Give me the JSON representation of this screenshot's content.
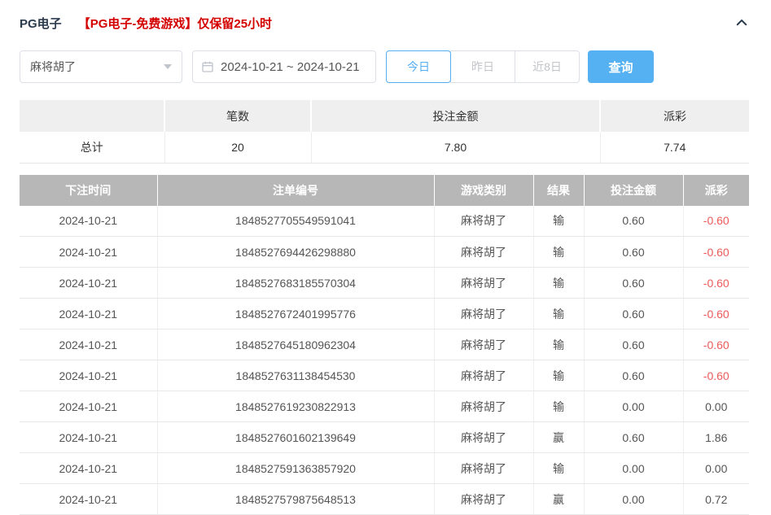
{
  "header": {
    "title": "PG电子",
    "notice": "【PG电子-免费游戏】仅保留25小时",
    "collapse_icon": "chevron-up"
  },
  "filters": {
    "game_select": {
      "value": "麻将胡了"
    },
    "date_range": {
      "value": "2024-10-21 ~ 2024-10-21",
      "icon": "calendar-icon"
    },
    "quick_buttons": [
      {
        "label": "今日",
        "active": true
      },
      {
        "label": "昨日",
        "active": false
      },
      {
        "label": "近8日",
        "active": false
      }
    ],
    "search_label": "查询"
  },
  "summary_table": {
    "headers": [
      "",
      "笔数",
      "投注金额",
      "派彩"
    ],
    "total_label": "总计",
    "count": "20",
    "bet_amount": "7.80",
    "payout": "7.74"
  },
  "bet_table": {
    "headers": [
      "下注时间",
      "注单编号",
      "游戏类别",
      "结果",
      "投注金额",
      "派彩"
    ],
    "rows": [
      [
        "2024-10-21",
        "1848527705549591041",
        "麻将胡了",
        "输",
        "0.60",
        "-0.60"
      ],
      [
        "2024-10-21",
        "1848527694426298880",
        "麻将胡了",
        "输",
        "0.60",
        "-0.60"
      ],
      [
        "2024-10-21",
        "1848527683185570304",
        "麻将胡了",
        "输",
        "0.60",
        "-0.60"
      ],
      [
        "2024-10-21",
        "1848527672401995776",
        "麻将胡了",
        "输",
        "0.60",
        "-0.60"
      ],
      [
        "2024-10-21",
        "1848527645180962304",
        "麻将胡了",
        "输",
        "0.60",
        "-0.60"
      ],
      [
        "2024-10-21",
        "1848527631138454530",
        "麻将胡了",
        "输",
        "0.60",
        "-0.60"
      ],
      [
        "2024-10-21",
        "1848527619230822913",
        "麻将胡了",
        "输",
        "0.00",
        "0.00"
      ],
      [
        "2024-10-21",
        "1848527601602139649",
        "麻将胡了",
        "赢",
        "0.60",
        "1.86"
      ],
      [
        "2024-10-21",
        "1848527591363857920",
        "麻将胡了",
        "输",
        "0.00",
        "0.00"
      ],
      [
        "2024-10-21",
        "1848527579875648513",
        "麻将胡了",
        "赢",
        "0.00",
        "0.72"
      ]
    ]
  },
  "colors": {
    "accent": "#54aef0",
    "btn_blue": "#55b1f2",
    "notice_red": "#d40000",
    "neg_red": "#ee5a5a",
    "thead_gray": "#b7b7b7"
  }
}
